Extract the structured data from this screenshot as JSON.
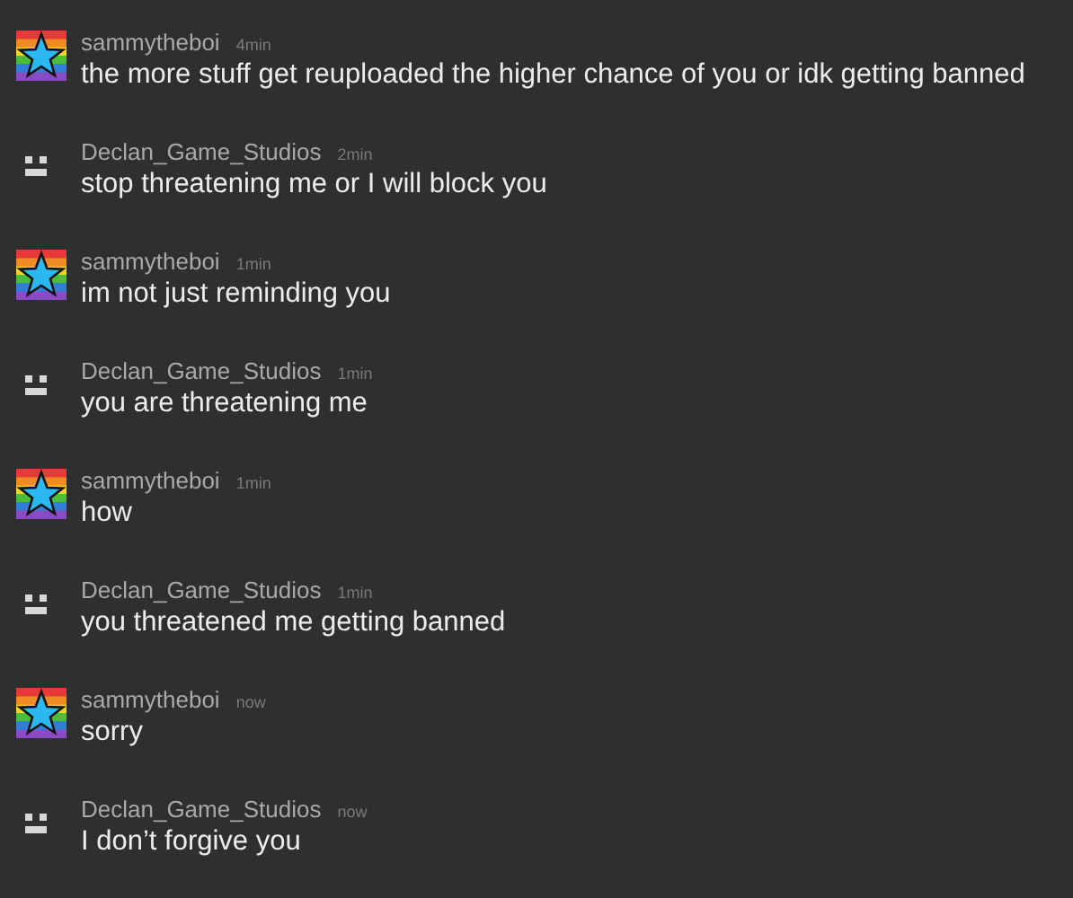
{
  "messages": [
    {
      "avatar": {
        "kind": "star"
      },
      "author": "sammytheboi",
      "time": "4min",
      "text": "the more stuff get reuploaded the higher chance of you or idk getting banned"
    },
    {
      "avatar": {
        "kind": "face"
      },
      "author": "Declan_Game_Studios",
      "time": "2min",
      "text": "stop threatening me or I will block you"
    },
    {
      "avatar": {
        "kind": "star"
      },
      "author": "sammytheboi",
      "time": "1min",
      "text": "im not just reminding you"
    },
    {
      "avatar": {
        "kind": "face"
      },
      "author": "Declan_Game_Studios",
      "time": "1min",
      "text": "you are threatening me"
    },
    {
      "avatar": {
        "kind": "star"
      },
      "author": "sammytheboi",
      "time": "1min",
      "text": "how"
    },
    {
      "avatar": {
        "kind": "face"
      },
      "author": "Declan_Game_Studios",
      "time": "1min",
      "text": "you threatened me getting banned"
    },
    {
      "avatar": {
        "kind": "star"
      },
      "author": "sammytheboi",
      "time": "now",
      "text": "sorry"
    },
    {
      "avatar": {
        "kind": "face"
      },
      "author": "Declan_Game_Studios",
      "time": "now",
      "text": "I don’t forgive you"
    }
  ]
}
